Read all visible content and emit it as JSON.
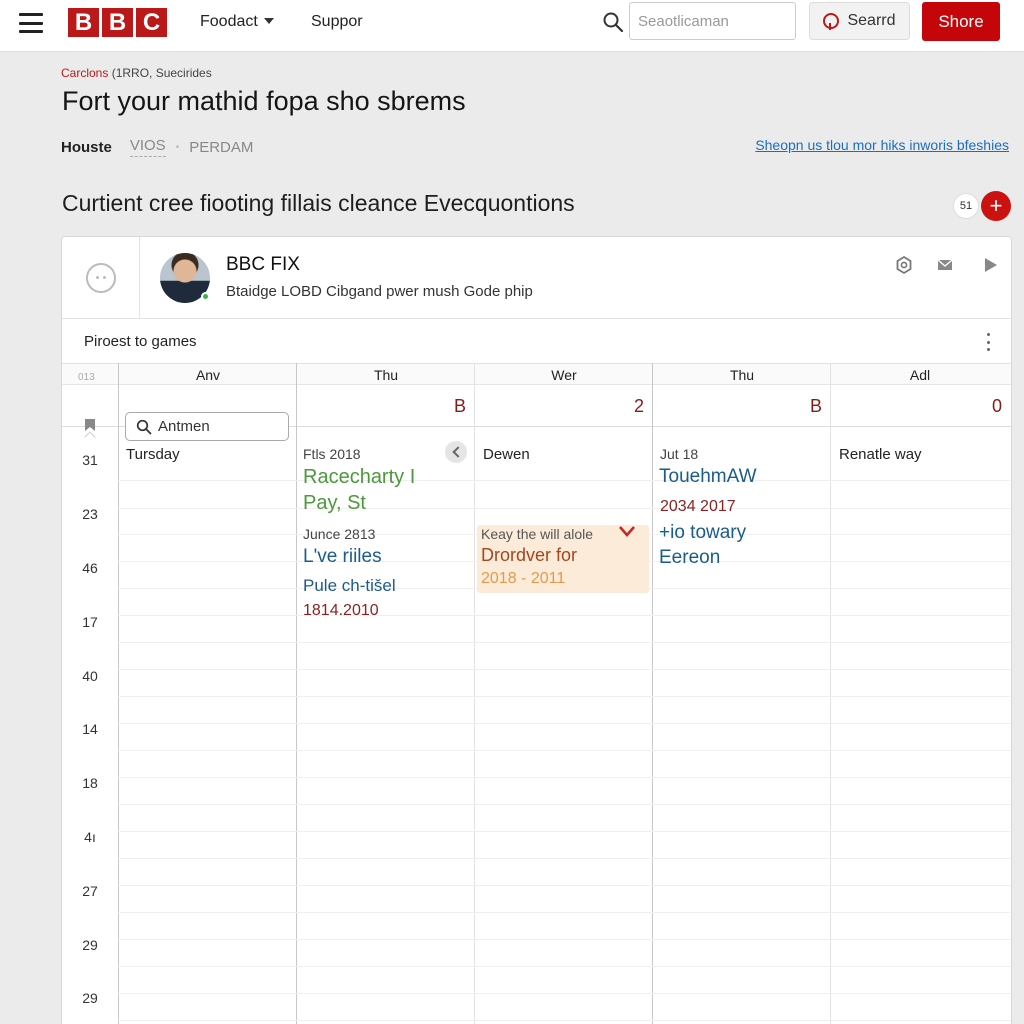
{
  "header": {
    "logo_letters": [
      "B",
      "B",
      "C"
    ],
    "nav": [
      {
        "label": "Foodact",
        "has_dropdown": true
      },
      {
        "label": "Suppor",
        "has_dropdown": false
      }
    ],
    "search_placeholder": "Seaotlicaman",
    "search_button_label": "Searrd",
    "share_button_label": "Shore",
    "brand_color": "#bb1919"
  },
  "page": {
    "breadcrumb_first": "Carclons",
    "breadcrumb_rest": " (1RRO, Suecirides",
    "title": "Fort your mathid fopa sho sbrems",
    "tabs": [
      "Houste",
      "VIOS",
      "PERDAM"
    ],
    "top_link": "Sheopn us tlou mor hiks inworis bfeshies",
    "section_title": "Curtient cree fiooting fillais cleance Evecquontions",
    "count_chip": "51"
  },
  "card": {
    "profile_name": "BBC FIX",
    "profile_sub": "Btaidge LOBD Cibgand pwer mush Gode phip",
    "games_label": "Piroest to games"
  },
  "calendar": {
    "corner_label": "013",
    "search_value": "Antmen",
    "days": [
      {
        "label": "Anv",
        "number": ""
      },
      {
        "label": "Thu",
        "number": "B"
      },
      {
        "label": "Wer",
        "number": "2"
      },
      {
        "label": "Thu",
        "number": "B"
      },
      {
        "label": "Adl",
        "number": "0"
      }
    ],
    "row_labels": [
      "31",
      "23",
      "46",
      "17",
      "40",
      "14",
      "18",
      "4ı",
      "27",
      "29",
      "29"
    ],
    "col1": {
      "heading": "Tursday"
    },
    "col2": {
      "date1": "Ftls 2018",
      "title1": "Racecharty I",
      "title1b": "Pay, St",
      "date2": "Junce 2813",
      "title2": "L've riiles",
      "sub2": "Pule ch-tišel",
      "years2": "1814.2010"
    },
    "col3": {
      "heading": "Dewen",
      "event_small": "Keay the will alole",
      "event_title": "Drordver for",
      "event_years": "2018 - 2011"
    },
    "col4": {
      "date": "Jut 18",
      "title": "TouehmAW",
      "years": "2034 2017",
      "title2a": "+io towary",
      "title2b": "Eereon"
    },
    "col5": {
      "heading": "Renatle way"
    }
  }
}
